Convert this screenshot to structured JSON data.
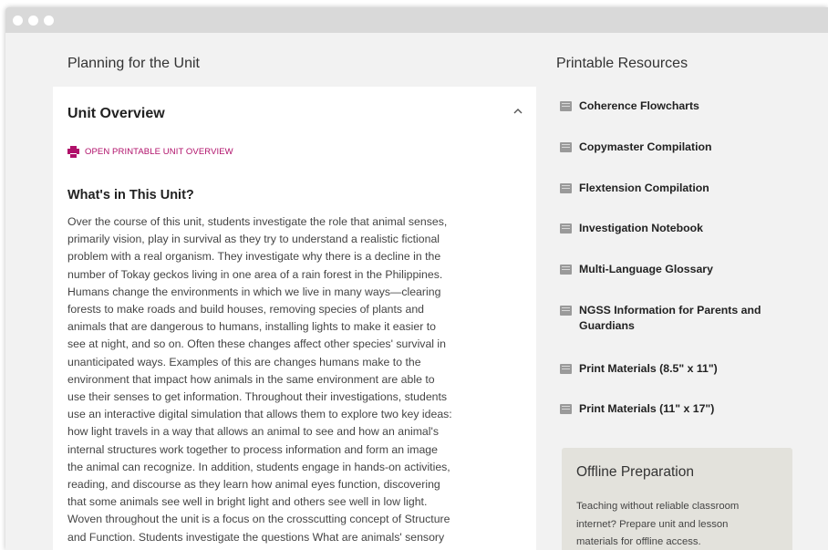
{
  "left_section": {
    "title": "Planning for the Unit"
  },
  "right_section": {
    "title": "Printable Resources"
  },
  "overview": {
    "title": "Unit Overview",
    "collapse_icon": "chevron-up-icon",
    "print_link": "OPEN PRINTABLE UNIT OVERVIEW",
    "print_icon": "printer-icon",
    "accent_color": "#b0106a",
    "section_title": "What's in This Unit?",
    "body_lines": [
      "Over the course of this unit, students investigate the role that animal senses,",
      "primarily vision, play in survival as they try to understand a realistic fictional",
      "problem with a real organism. They investigate why there is a decline in the",
      "number of Tokay geckos living in one area of a rain forest in the Philippines.",
      "Humans change the environments in which we live in many ways—clearing",
      "forests to make roads and build houses, removing species of plants and",
      "animals that are dangerous to humans, installing lights to make it easier to",
      "see at night, and so on. Often these changes affect other species' survival in",
      "unanticipated ways. Examples of this are changes humans make to the",
      "environment that impact how animals in the same environment are able to",
      "use their senses to get information. Throughout their investigations, students",
      "use an interactive digital simulation that allows them to explore two key ideas:",
      "how light travels in a way that allows an animal to see and how an animal's",
      "internal structures work together to process information and form an image",
      "the animal can recognize. In addition, students engage in hands-on activities,",
      "reading, and discourse as they learn how animal eyes function, discovering",
      "that some animals see well in bright light and others see well in low light.",
      "Woven throughout the unit is a focus on the crosscutting concept of Structure",
      "and Function. Students investigate the questions What are animals' sensory"
    ]
  },
  "resources": {
    "icon": "pdf-icon",
    "items": [
      {
        "label": "Coherence Flowcharts"
      },
      {
        "label": "Copymaster Compilation"
      },
      {
        "label": "Flextension Compilation"
      },
      {
        "label": "Investigation Notebook"
      },
      {
        "label": "Multi-Language Glossary"
      },
      {
        "label": "NGSS Information for Parents and Guardians"
      },
      {
        "label": "Print Materials (8.5\" x 11\")"
      },
      {
        "label": "Print Materials (11\" x 17\")"
      }
    ]
  },
  "offline": {
    "title": "Offline Preparation",
    "text_lines": [
      "Teaching without reliable classroom",
      "internet? Prepare unit and lesson",
      "materials for offline access."
    ]
  }
}
